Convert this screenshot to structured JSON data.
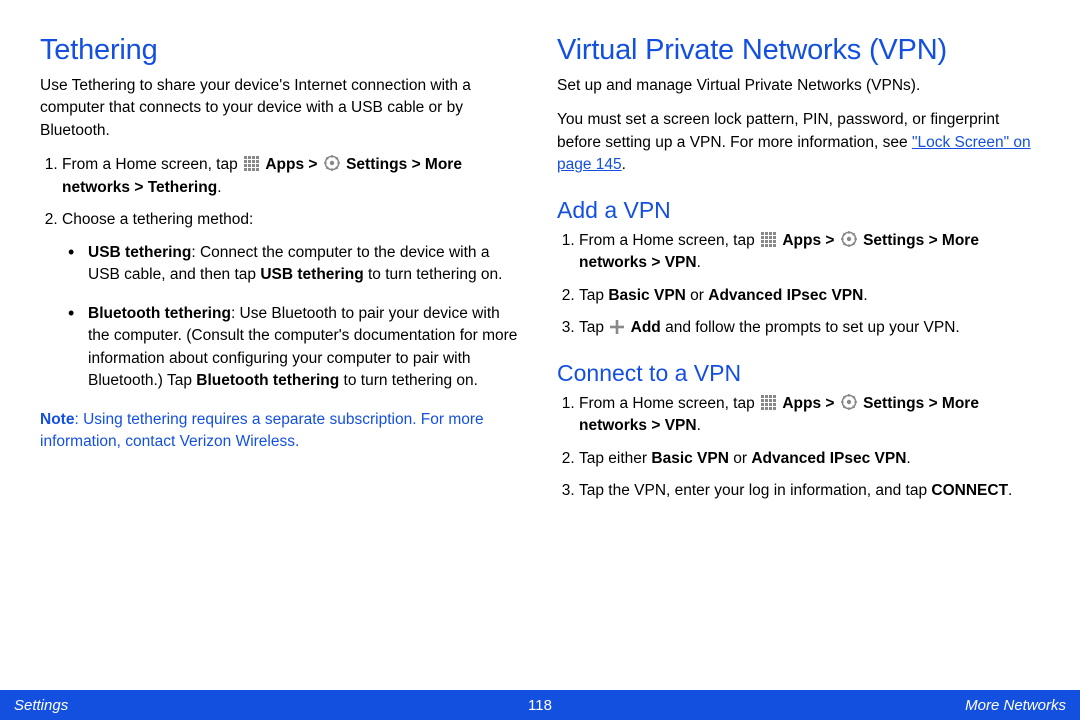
{
  "left": {
    "heading": "Tethering",
    "intro": "Use Tethering to share your device's Internet connection with a computer that connects to your device with a USB cable or by Bluetooth.",
    "step1_pre": "From a Home screen, tap ",
    "step1_apps": "Apps",
    "step1_sep1": " > ",
    "step1_settings": "Settings",
    "step1_sep2": " > ",
    "step1_path": "More networks > Tethering",
    "step1_end": ".",
    "step2": "Choose a tethering method:",
    "usb_label": "USB tethering",
    "usb_body": ": Connect the computer to the device with a USB cable, and then tap ",
    "usb_action": "USB tethering",
    "usb_end": " to turn tethering on.",
    "bt_label": "Bluetooth tethering",
    "bt_body": ": Use Bluetooth to pair your device with the computer. (Consult the computer's documentation for more information about configuring your computer to pair with Bluetooth.) Tap ",
    "bt_action": "Bluetooth tethering",
    "bt_end": " to turn tethering on.",
    "note_label": "Note",
    "note_body": ": Using tethering requires a separate subscription. For more information, contact Verizon Wireless."
  },
  "right": {
    "heading": "Virtual Private Networks (VPN)",
    "intro1": "Set up and manage Virtual Private Networks (VPNs).",
    "intro2_a": "You must set a screen lock pattern, PIN, password, or fingerprint before setting up a VPN. For more information, see ",
    "intro2_link": "\"Lock Screen\" on page 145",
    "intro2_b": ".",
    "add_heading": "Add a VPN",
    "add1_pre": "From a Home screen, tap ",
    "add1_apps": "Apps",
    "add1_sep1": " > ",
    "add1_settings": "Settings",
    "add1_sep2": " > ",
    "add1_path": "More networks > VPN",
    "add1_end": ".",
    "add2_a": "Tap ",
    "add2_b1": "Basic VPN",
    "add2_mid": " or ",
    "add2_b2": "Advanced IPsec VPN",
    "add2_end": ".",
    "add3_a": "Tap ",
    "add3_add": "Add",
    "add3_b": " and follow the prompts to set up your VPN.",
    "conn_heading": "Connect to a VPN",
    "conn1_pre": "From a Home screen, tap ",
    "conn1_apps": "Apps",
    "conn1_sep1": " > ",
    "conn1_settings": "Settings",
    "conn1_sep2": " > ",
    "conn1_path": "More networks > VPN",
    "conn1_end": ".",
    "conn2_a": "Tap either ",
    "conn2_b1": "Basic VPN",
    "conn2_mid": " or ",
    "conn2_b2": "Advanced IPsec VPN",
    "conn2_end": ".",
    "conn3_a": "Tap the VPN, enter your log in information, and tap ",
    "conn3_b": "CONNECT",
    "conn3_end": "."
  },
  "footer": {
    "left": "Settings",
    "center": "118",
    "right": "More Networks"
  }
}
